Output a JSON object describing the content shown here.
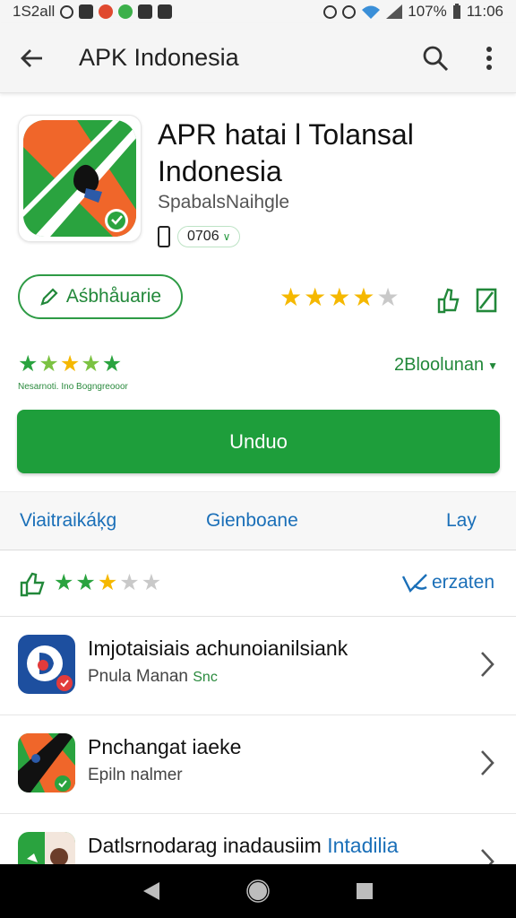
{
  "status_bar": {
    "left_text": "1S2all",
    "battery": "107%",
    "time": "11:06"
  },
  "app_bar": {
    "title": "APK Indonesia",
    "icons": [
      "back-arrow-icon",
      "search-icon",
      "more-vert-icon"
    ]
  },
  "app": {
    "name": "APR hatai l Tolansal Indonesia",
    "developer": "SpabalsNaihgle",
    "chip_value": "0706",
    "icon_colors": {
      "green": "#2aa33f",
      "orange": "#f0662a"
    }
  },
  "actions": {
    "wishlist_label": "Aśbhåuarie",
    "rating_stars": 4.5,
    "downloads": "2Bloolunan"
  },
  "rating_summary": {
    "stars": 5,
    "caption": "Nesarnoti. Ino Bogngreooor"
  },
  "install": {
    "label": "Unduo"
  },
  "tabs": [
    {
      "label": "Viaitraikáķg"
    },
    {
      "label": "Gienboane"
    },
    {
      "label": "Lay"
    }
  ],
  "reviews": {
    "stars": 3,
    "link": "erzaten"
  },
  "list": [
    {
      "title": "Imjotaisiais achunoianilsiank",
      "subtitle": "Pnula Manan",
      "tag": "Snc"
    },
    {
      "title": "Pnchangat iaeke",
      "subtitle": "Epiln  nalmer",
      "tag": ""
    },
    {
      "title": "Datlsrnodarag inadausiim",
      "highlight": "Intadilia",
      "subtitle": "",
      "tag": ""
    }
  ],
  "colors": {
    "accent_green": "#1e9e3b",
    "link_blue": "#1a6fb8",
    "star_gold": "#f5b800"
  }
}
